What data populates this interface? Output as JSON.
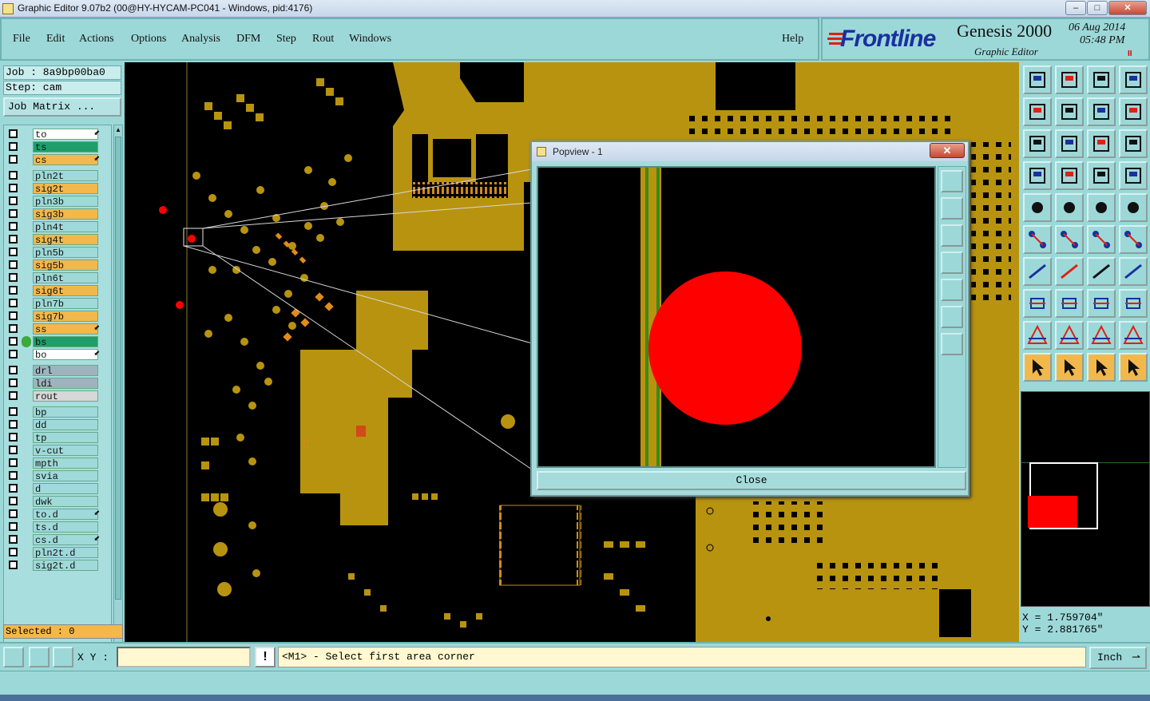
{
  "window": {
    "title": "Graphic Editor 9.07b2 (00@HY-HYCAM-PC041 - Windows, pid:4176)",
    "min": "–",
    "max": "□",
    "close": "✕"
  },
  "menu": {
    "items": [
      "File",
      "Edit",
      "Actions",
      "Options",
      "Analysis",
      "DFM",
      "Step",
      "Rout",
      "Windows"
    ],
    "help": "Help"
  },
  "brand": {
    "logo": "Frontline",
    "product": "Genesis 2000",
    "subtitle": "Graphic Editor",
    "date": "06 Aug 2014",
    "time": "05:48 PM",
    "pause": "II"
  },
  "job": {
    "job_label": "Job : 8a9bp00ba0",
    "step_label": "Step: cam",
    "matrix_button": "Job Matrix ..."
  },
  "layers": [
    {
      "name": "to",
      "color": "#ffffff",
      "arrow": true
    },
    {
      "name": "ts",
      "color": "#1f9e6a",
      "arrow": false
    },
    {
      "name": "cs",
      "color": "#f2b84b",
      "arrow": true
    },
    {
      "name": "pln2t",
      "color": "#9fd9d9",
      "arrow": false
    },
    {
      "name": "sig2t",
      "color": "#f2b84b",
      "arrow": false
    },
    {
      "name": "pln3b",
      "color": "#9fd9d9",
      "arrow": false
    },
    {
      "name": "sig3b",
      "color": "#f2b84b",
      "arrow": false
    },
    {
      "name": "pln4t",
      "color": "#9fd9d9",
      "arrow": false
    },
    {
      "name": "sig4t",
      "color": "#f2b84b",
      "arrow": false
    },
    {
      "name": "pln5b",
      "color": "#9fd9d9",
      "arrow": false
    },
    {
      "name": "sig5b",
      "color": "#f2b84b",
      "arrow": false
    },
    {
      "name": "pln6t",
      "color": "#9fd9d9",
      "arrow": false
    },
    {
      "name": "sig6t",
      "color": "#f2b84b",
      "arrow": false
    },
    {
      "name": "pln7b",
      "color": "#9fd9d9",
      "arrow": false
    },
    {
      "name": "sig7b",
      "color": "#f2b84b",
      "arrow": false
    },
    {
      "name": "ss",
      "color": "#f2b84b",
      "arrow": true
    },
    {
      "name": "bs",
      "color": "#1f9e6a",
      "arrow": false,
      "active": true
    },
    {
      "name": "bo",
      "color": "#ffffff",
      "arrow": true
    },
    {
      "name": "drl",
      "color": "#9fb3bf",
      "arrow": false
    },
    {
      "name": "ldi",
      "color": "#9fb3bf",
      "arrow": false
    },
    {
      "name": "rout",
      "color": "#d7d7d7",
      "arrow": false
    },
    {
      "name": "bp",
      "color": "#9fd9d9",
      "arrow": false
    },
    {
      "name": "dd",
      "color": "#9fd9d9",
      "arrow": false
    },
    {
      "name": "tp",
      "color": "#9fd9d9",
      "arrow": false
    },
    {
      "name": "v-cut",
      "color": "#9fd9d9",
      "arrow": false
    },
    {
      "name": "mpth",
      "color": "#9fd9d9",
      "arrow": false
    },
    {
      "name": "svia",
      "color": "#9fd9d9",
      "arrow": false
    },
    {
      "name": "d",
      "color": "#9fd9d9",
      "arrow": false
    },
    {
      "name": "dwk",
      "color": "#9fd9d9",
      "arrow": false
    },
    {
      "name": "to.d",
      "color": "#9fd9d9",
      "arrow": true
    },
    {
      "name": "ts.d",
      "color": "#9fd9d9",
      "arrow": false
    },
    {
      "name": "cs.d",
      "color": "#9fd9d9",
      "arrow": true
    },
    {
      "name": "pln2t.d",
      "color": "#9fd9d9",
      "arrow": false
    },
    {
      "name": "sig2t.d",
      "color": "#9fd9d9",
      "arrow": false
    }
  ],
  "selected": "Selected : 0",
  "popview": {
    "title": "Popview - 1",
    "close_button": "Close",
    "close_x": "✕"
  },
  "coords": {
    "x": "X = 1.759704\"",
    "y": "Y = 2.881765\""
  },
  "bottom": {
    "xy_label": "X Y :",
    "xy_value": "",
    "warn": "!",
    "prompt": "<M1> - Select first area corner",
    "units": "Inch"
  },
  "colors": {
    "copper": "#b8930f",
    "highlight": "#ff0000",
    "panel": "#9dd8d8",
    "layer_signal": "#f2b84b",
    "layer_plane": "#9fd9d9"
  }
}
